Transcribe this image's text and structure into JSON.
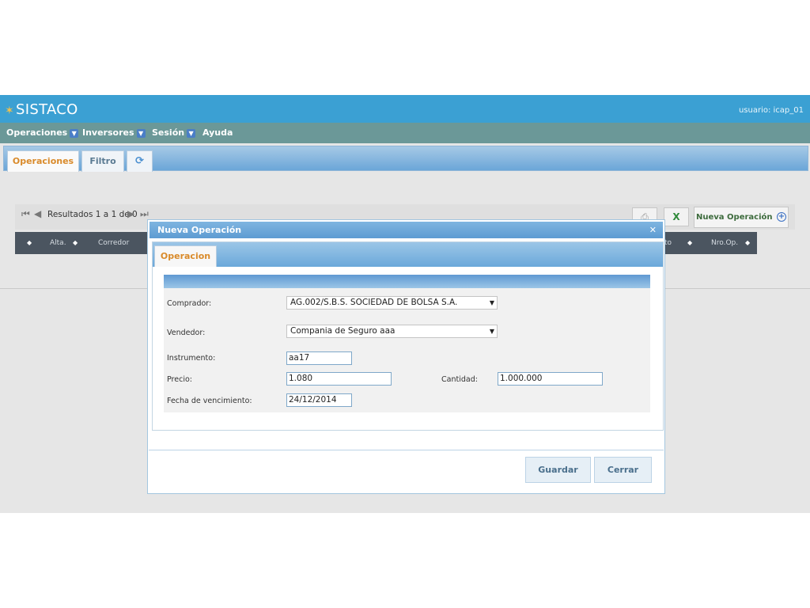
{
  "app": {
    "title": "SISTACO",
    "user_label": "usuario: icap_01"
  },
  "menu": {
    "items": [
      "Operaciones",
      "Inversores",
      "Sesión",
      "Ayuda"
    ]
  },
  "tabs": {
    "operaciones": "Operaciones",
    "filtro": "Filtro"
  },
  "results": {
    "text": "Resultados 1 a 1  de 0",
    "new_operation": "Nueva Operación"
  },
  "table": {
    "columns": [
      "Alta.",
      "Corredor",
      "to",
      "Nro.Op."
    ]
  },
  "modal": {
    "title": "Nueva Operación",
    "tab": "Operacion",
    "fields": {
      "comprador_label": "Comprador:",
      "comprador_value": "AG.002/S.B.S. SOCIEDAD DE BOLSA S.A.",
      "vendedor_label": "Vendedor:",
      "vendedor_value": "Compania de Seguro aaa",
      "instrumento_label": "Instrumento:",
      "instrumento_value": "aa17",
      "precio_label": "Precio:",
      "precio_value": "1.080",
      "cantidad_label": "Cantidad:",
      "cantidad_value": "1.000.000",
      "fecha_label": "Fecha de vencimiento:",
      "fecha_value": "24/12/2014"
    },
    "buttons": {
      "save": "Guardar",
      "close": "Cerrar"
    }
  },
  "colors": {
    "header": "#3ba0d3",
    "menu": "#6b9898",
    "accent": "#d98a2a"
  }
}
